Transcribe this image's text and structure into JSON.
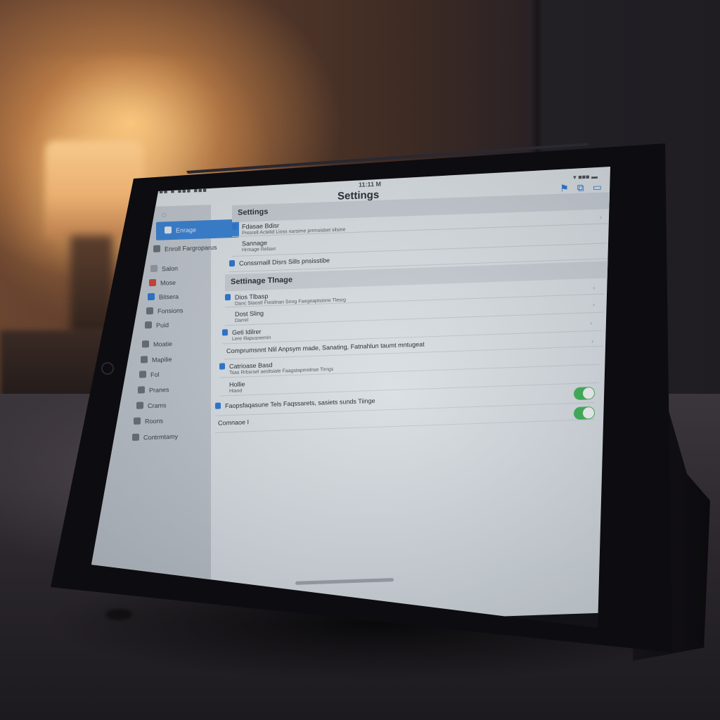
{
  "statusbar": {
    "carrier": "■■■ ■ ■■■ ■■■",
    "time": "11:11 M",
    "battery": "▾ ■■■ ▬"
  },
  "header": {
    "title": "Settings"
  },
  "sidebar": {
    "items": [
      {
        "label": "Enrage",
        "selected": true
      },
      {
        "label": "Enroll Fargroparus",
        "selected": false
      },
      {
        "label": "Salon",
        "selected": false
      },
      {
        "label": "Mose",
        "selected": false
      },
      {
        "label": "Bitsera",
        "selected": false
      },
      {
        "label": "Fonsions",
        "selected": false
      },
      {
        "label": "Puid",
        "selected": false
      },
      {
        "label": "Moatie",
        "selected": false
      },
      {
        "label": "Mapilie",
        "selected": false
      },
      {
        "label": "Fol",
        "selected": false
      },
      {
        "label": "Pranes",
        "selected": false
      },
      {
        "label": "Crams",
        "selected": false
      },
      {
        "label": "Roons",
        "selected": false
      },
      {
        "label": "Contrmtamy",
        "selected": false
      }
    ]
  },
  "main": {
    "sections": [
      {
        "title": "Settings",
        "rows": [
          {
            "label": "Fdasae Bdisr",
            "detail": "Presrell Actelid Lioss narsime prrmsisbet silsine",
            "icon": true
          },
          {
            "label": "Sannage",
            "detail": "Hrmage Reliavr",
            "icon": false
          },
          {
            "label": "Conssrnaill Disrs Sills pnsisstibe",
            "detail": "",
            "icon": true
          }
        ]
      },
      {
        "title": "Settinage Tlnage",
        "rows": [
          {
            "label": "Dios Tlbasp",
            "detail": "Danc Staostl Fiesitnan Snng Faegeaptsione Tlesrg",
            "icon": true
          },
          {
            "label": "Dost Sling",
            "detail": "Darrel",
            "icon": false
          },
          {
            "label": "Geti Idilrer",
            "detail": "Lere Illapusnemin",
            "icon": true
          },
          {
            "label": "Comprumsnnt Nlil Anpsym made, Sanating, Fatnahlun taumt mntugeat",
            "detail": "",
            "icon": false
          },
          {
            "label": "Catrioase Basd",
            "detail": "Tsas Rrbsrsel aesltsiale Faagstapmolnse Tirngs",
            "icon": true
          },
          {
            "label": "Hollie",
            "detail": "Hiaod",
            "icon": false
          },
          {
            "label": "Faopsfaqasune Tels Faqssarets, sasiets sunds Tiinge",
            "detail": "",
            "icon": true,
            "toggle": true
          },
          {
            "label": "Comnaoe I",
            "detail": "",
            "icon": false,
            "toggle": true
          }
        ]
      }
    ]
  },
  "colors": {
    "accent": "#3b86d9",
    "toggle_on": "#43b35b"
  }
}
